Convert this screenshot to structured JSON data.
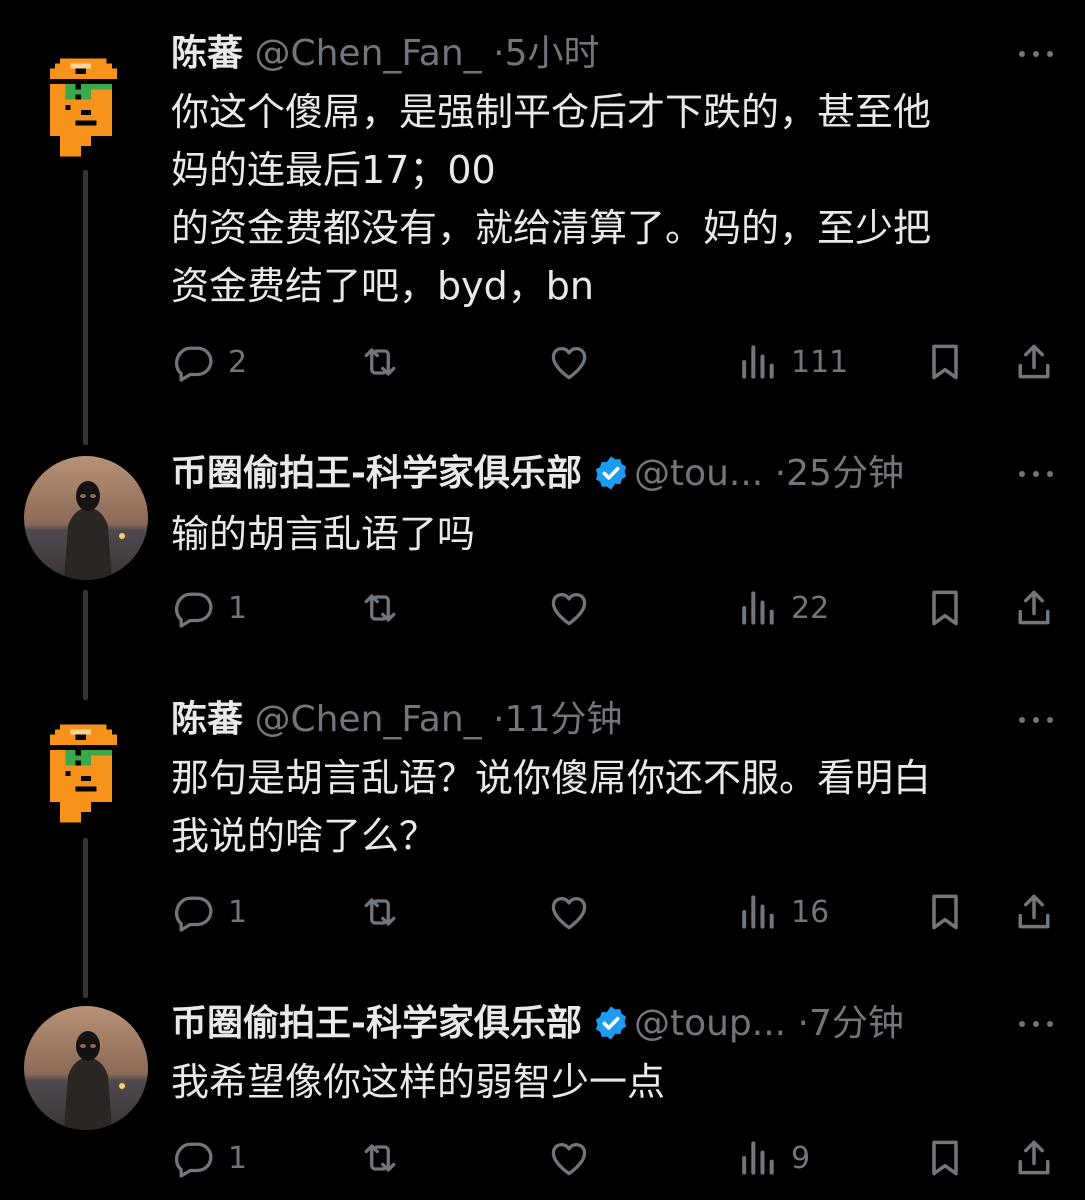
{
  "tweets": [
    {
      "name": "陈蕃",
      "handle": "@Chen_Fan_",
      "dot": "·",
      "time": "5小时",
      "verified": false,
      "avatar": "pixel-art-avatar",
      "text": "你这个傻屌，是强制平仓后才下跌的，甚至他\n妈的连最后17；00\n的资金费都没有，就给清算了。妈的，至少把\n资金费结了吧，byd，bn",
      "reply_count": "2",
      "retweet_count": "",
      "like_count": "",
      "view_count": "111"
    },
    {
      "name": "币圈偷拍王-科学家俱乐部",
      "handle": "@tou...",
      "dot": "·",
      "time": "25分钟",
      "verified": true,
      "avatar": "masked-person-avatar",
      "text": "输的胡言乱语了吗",
      "reply_count": "1",
      "retweet_count": "",
      "like_count": "",
      "view_count": "22"
    },
    {
      "name": "陈蕃",
      "handle": "@Chen_Fan_",
      "dot": "·",
      "time": "11分钟",
      "verified": false,
      "avatar": "pixel-art-avatar",
      "text": "那句是胡言乱语？说你傻屌你还不服。看明白\n我说的啥了么？",
      "reply_count": "1",
      "retweet_count": "",
      "like_count": "",
      "view_count": "16"
    },
    {
      "name": "币圈偷拍王-科学家俱乐部",
      "handle": "@toup...",
      "dot": "·",
      "time": "7分钟",
      "verified": true,
      "avatar": "masked-person-avatar",
      "text": "我希望像你这样的弱智少一点",
      "reply_count": "1",
      "retweet_count": "",
      "like_count": "",
      "view_count": "9"
    }
  ],
  "icons": {
    "reply": "reply-icon",
    "retweet": "retweet-icon",
    "like": "heart-icon",
    "views": "views-icon",
    "bookmark": "bookmark-icon",
    "share": "share-icon",
    "more": "more-icon",
    "verified": "verified-badge-icon"
  },
  "colors": {
    "background": "#000000",
    "primary_text": "#e7e9ea",
    "secondary_text": "#71767b",
    "verified_blue": "#1d9bf0",
    "thread_line": "#333639",
    "pixel_avatar_orange": "#f7931a"
  }
}
